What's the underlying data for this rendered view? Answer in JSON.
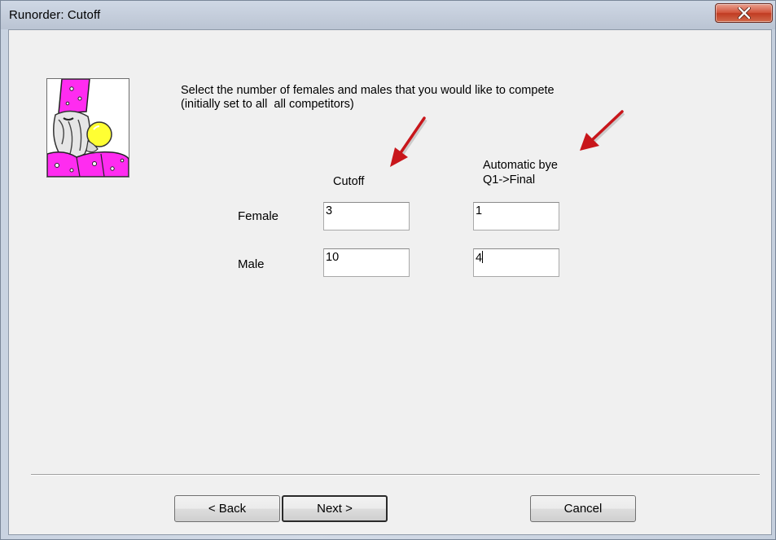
{
  "window": {
    "title": "Runorder: Cutoff"
  },
  "instruction": {
    "line1": "Select the number of females and males that you would like to compete",
    "line2": "(initially set to all  all competitors)"
  },
  "columns": {
    "cutoff": "Cutoff",
    "bye_line1": "Automatic bye",
    "bye_line2": "Q1->Final"
  },
  "rows": [
    {
      "label": "Female",
      "cutoff": "3",
      "bye": "1"
    },
    {
      "label": "Male",
      "cutoff": "10",
      "bye": "4"
    }
  ],
  "buttons": {
    "back": "< Back",
    "next": "Next >",
    "cancel": "Cancel"
  },
  "colors": {
    "annotation_arrow": "#c8161b",
    "close_button": "#c7432a"
  },
  "icons": {
    "close": "close-icon",
    "wizard": "wizard-image",
    "arrow": "annotation-arrow-icon"
  }
}
